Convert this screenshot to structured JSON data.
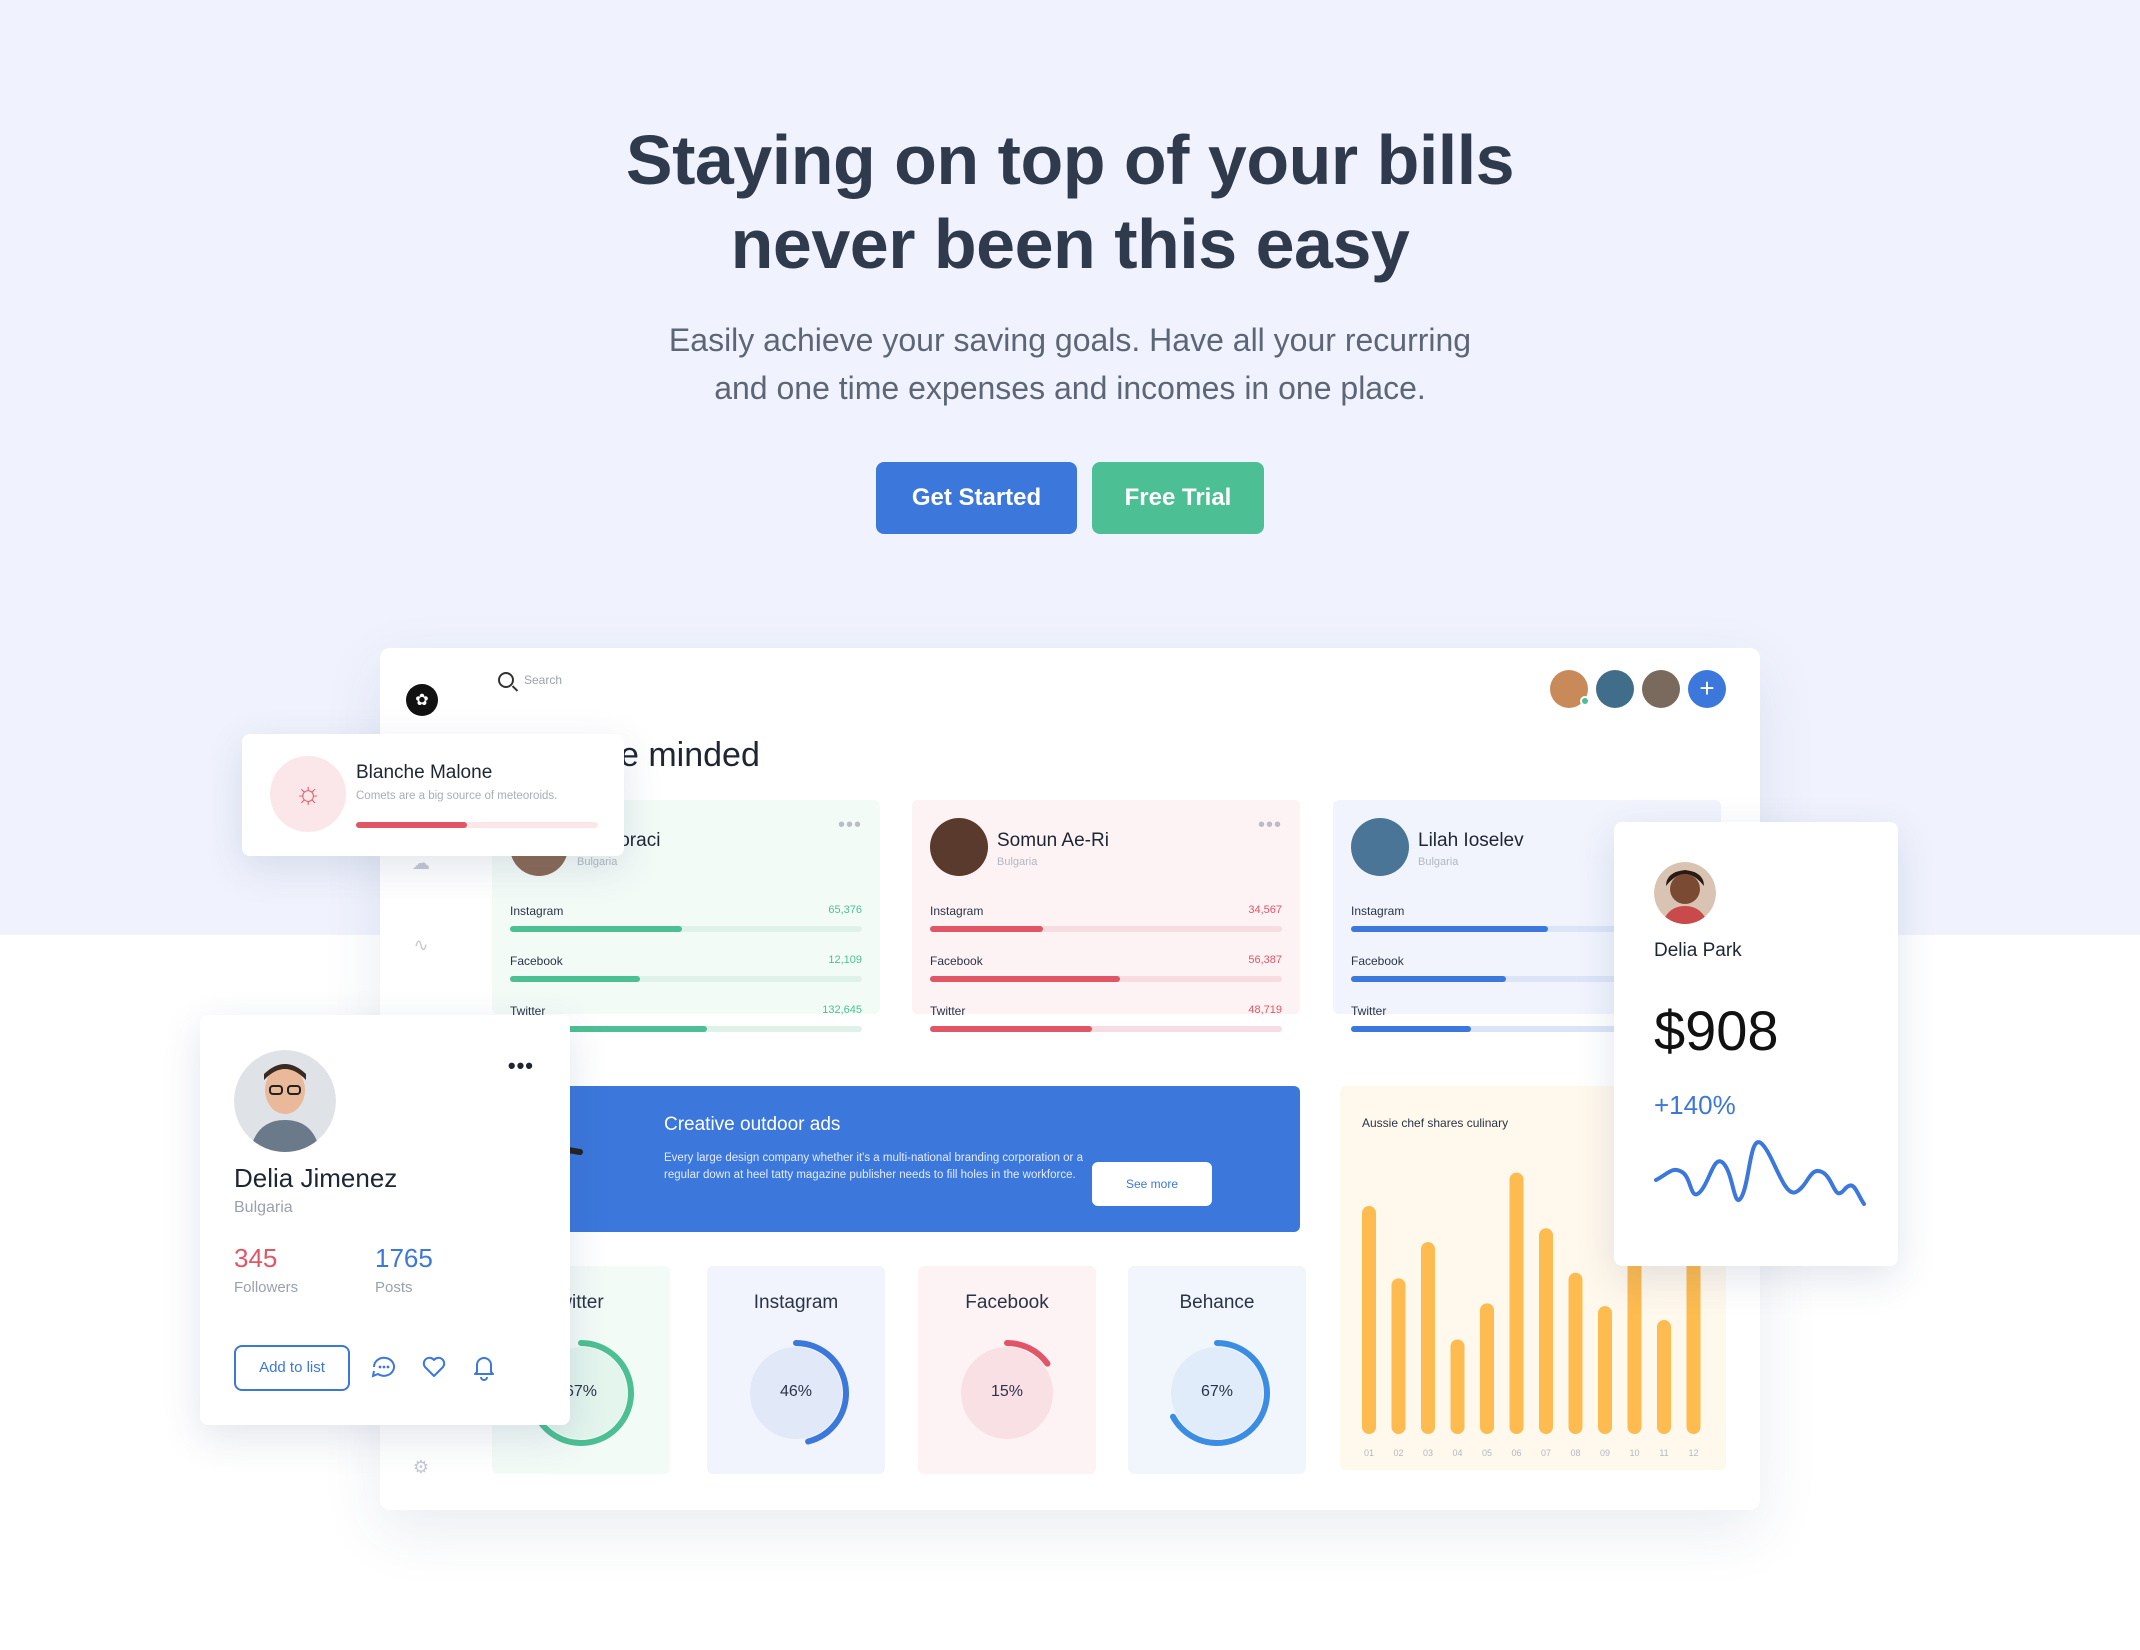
{
  "hero": {
    "title_line1": "Staying on top of your bills",
    "title_line2": "never been this easy",
    "subtitle_line1": "Easily achieve your saving goals. Have all your recurring",
    "subtitle_line2": "and one time expenses and incomes in one place.",
    "primary_button": "Get Started",
    "secondary_button": "Free Trial"
  },
  "colors": {
    "blue": "#3c77db",
    "green": "#4dbf94",
    "red": "#e05666",
    "orange": "#fdbb50"
  },
  "dashboard": {
    "search_placeholder": "Search",
    "section_title": "e minded",
    "cards": [
      {
        "name": "Gregoraci",
        "location": "Bulgaria",
        "color": "#4dbf94",
        "bg": "#f3fbf7",
        "track": "#dff2ea",
        "metrics": [
          {
            "label": "Instagram",
            "value": "65,376",
            "fraction": 0.49
          },
          {
            "label": "Facebook",
            "value": "12,109",
            "fraction": 0.37
          },
          {
            "label": "Twitter",
            "value": "132,645",
            "fraction": 0.56
          }
        ]
      },
      {
        "name": "Somun Ae-Ri",
        "location": "Bulgaria",
        "color": "#e05666",
        "bg": "#fdf2f4",
        "track": "#f7dde1",
        "metrics": [
          {
            "label": "Instagram",
            "value": "34,567",
            "fraction": 0.32
          },
          {
            "label": "Facebook",
            "value": "56,387",
            "fraction": 0.54
          },
          {
            "label": "Twitter",
            "value": "48,719",
            "fraction": 0.46
          }
        ]
      },
      {
        "name": "Lilah Ioselev",
        "location": "Bulgaria",
        "color": "#3c77db",
        "bg": "#f1f4fd",
        "track": "#dce5f8",
        "metrics": [
          {
            "label": "Instagram",
            "value": "",
            "fraction": 0.56
          },
          {
            "label": "Facebook",
            "value": "",
            "fraction": 0.44
          },
          {
            "label": "Twitter",
            "value": "",
            "fraction": 0.34
          }
        ]
      }
    ],
    "banner": {
      "title": "Creative outdoor ads",
      "body": "Every large design company whether it's a multi-national branding corporation or a regular down at heel tatty magazine publisher needs to fill holes in the workforce.",
      "button": "See more"
    },
    "socials": [
      {
        "title": "witter",
        "percent": "67%",
        "fraction": 0.67,
        "color": "#4dbf94",
        "bg": "#f3fbf7",
        "inner": "#e3f5ed"
      },
      {
        "title": "Instagram",
        "percent": "46%",
        "fraction": 0.46,
        "color": "#3c77db",
        "bg": "#f1f4fd",
        "inner": "#e1e8f8"
      },
      {
        "title": "Facebook",
        "percent": "15%",
        "fraction": 0.15,
        "color": "#e05666",
        "bg": "#fdf2f4",
        "inner": "#f9e0e4"
      },
      {
        "title": "Behance",
        "percent": "67%",
        "fraction": 0.67,
        "color": "#3b8de3",
        "bg": "#f1f6fd",
        "inner": "#e0ecf9"
      }
    ]
  },
  "chart_data": {
    "type": "bar",
    "title": "Aussie chef shares culinary",
    "categories": [
      "01",
      "02",
      "03",
      "04",
      "05",
      "06",
      "07",
      "08",
      "09",
      "10",
      "11",
      "12"
    ],
    "values": [
      82,
      56,
      69,
      34,
      47,
      94,
      74,
      58,
      46,
      74,
      41,
      88
    ],
    "ylim": [
      0,
      100
    ],
    "color": "#fdbb50"
  },
  "notification": {
    "name": "Blanche Malone",
    "description": "Comets are a big source of meteoroids.",
    "progress": 0.46
  },
  "profile": {
    "name": "Delia Jimenez",
    "location": "Bulgaria",
    "followers_value": "345",
    "followers_label": "Followers",
    "posts_value": "1765",
    "posts_label": "Posts",
    "add_button": "Add to list"
  },
  "stat_card": {
    "name": "Delia Park",
    "amount": "$908",
    "change": "+140%"
  }
}
